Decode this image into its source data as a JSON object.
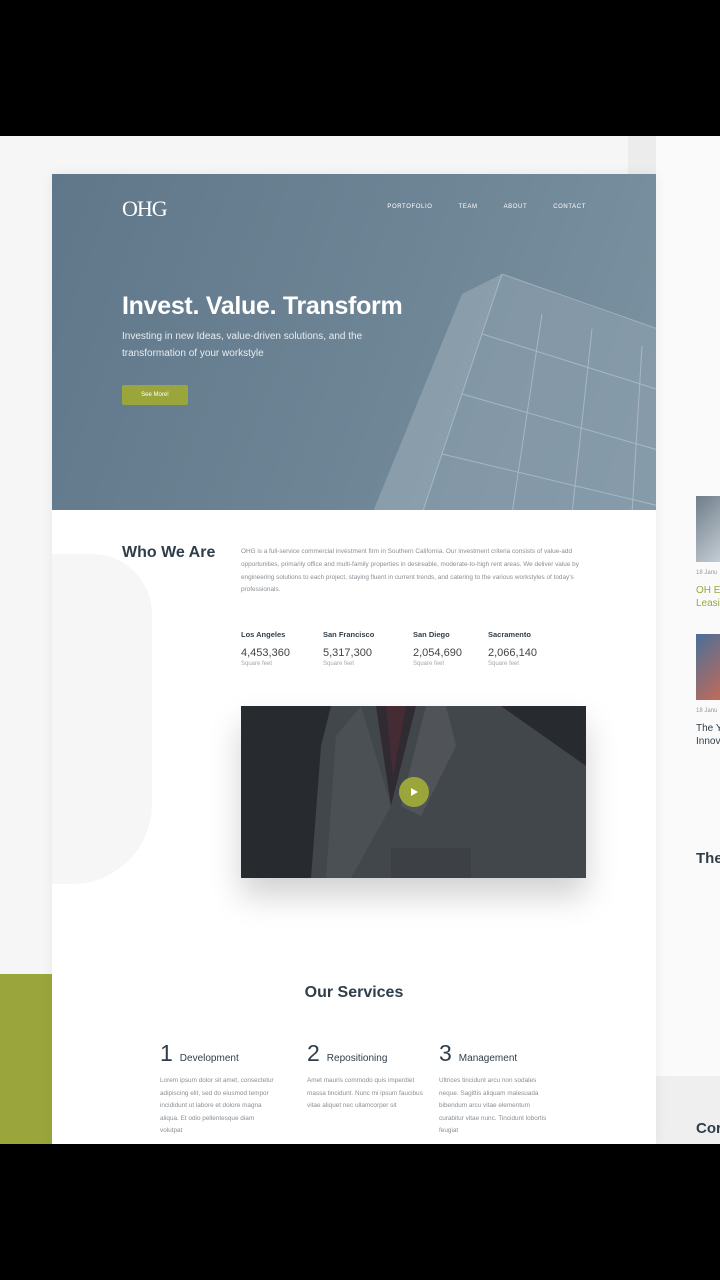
{
  "colors": {
    "accent": "#9aa63c",
    "hero": "#6a8193",
    "heading": "#2f3e4a"
  },
  "header": {
    "logo": "OHG",
    "nav": [
      "PORTOFOLIO",
      "TEAM",
      "ABOUT",
      "CONTACT"
    ]
  },
  "hero": {
    "title": "Invest. Value. Transform",
    "subtitle": "Investing in new Ideas, value-driven solutions, and the transformation of your workstyle",
    "button": "See More!"
  },
  "about": {
    "title": "Who We Are",
    "text": "OHG is a full-service commercial investment firm in Southern California. Our investment criteria consists of value-add opportunities, primarily office and multi-family properties in desireable, moderate-to-high rent areas. We deliver value by engineering solutions to each project, staying fluent in current trends, and catering to the various workstyles of today's professionals."
  },
  "stats": [
    {
      "city": "Los Angeles",
      "value": "4,453,360",
      "unit": "Square feet"
    },
    {
      "city": "San Francisco",
      "value": "5,317,300",
      "unit": "Square feet"
    },
    {
      "city": "San Diego",
      "value": "2,054,690",
      "unit": "Square feet"
    },
    {
      "city": "Sacramento",
      "value": "2,066,140",
      "unit": "Square feet"
    }
  ],
  "video": {
    "icon": "play-icon"
  },
  "services": {
    "title": "Our Services",
    "items": [
      {
        "num": "1",
        "name": "Development",
        "text": "Lorem ipsum dolor sit amet, consectetur adipiscing elit, sed do eiusmod tempor incididunt ut labore et dolore magna aliqua. Et odio pellentesque diam volutpat"
      },
      {
        "num": "2",
        "name": "Repositioning",
        "text": "Amet mauris commodo quis imperdiet massa tincidunt. Nunc mi ipsum faucibus vitae aliquet nec ullamcorper sit"
      },
      {
        "num": "3",
        "name": "Management",
        "text": "Ultrices tincidunt arcu non sodales neque. Sagittis aliquam malesuada bibendum arcu vitae elementum curabitur vitae nunc. Tincidunt lobortis feugiat"
      }
    ]
  },
  "side": {
    "date1": "18 Janu",
    "title1": [
      "OH E",
      "Leasi"
    ],
    "date2": "18 Janu",
    "title2": [
      "The Y",
      "Innov"
    ],
    "heading1": "The",
    "heading2": "Cor"
  }
}
